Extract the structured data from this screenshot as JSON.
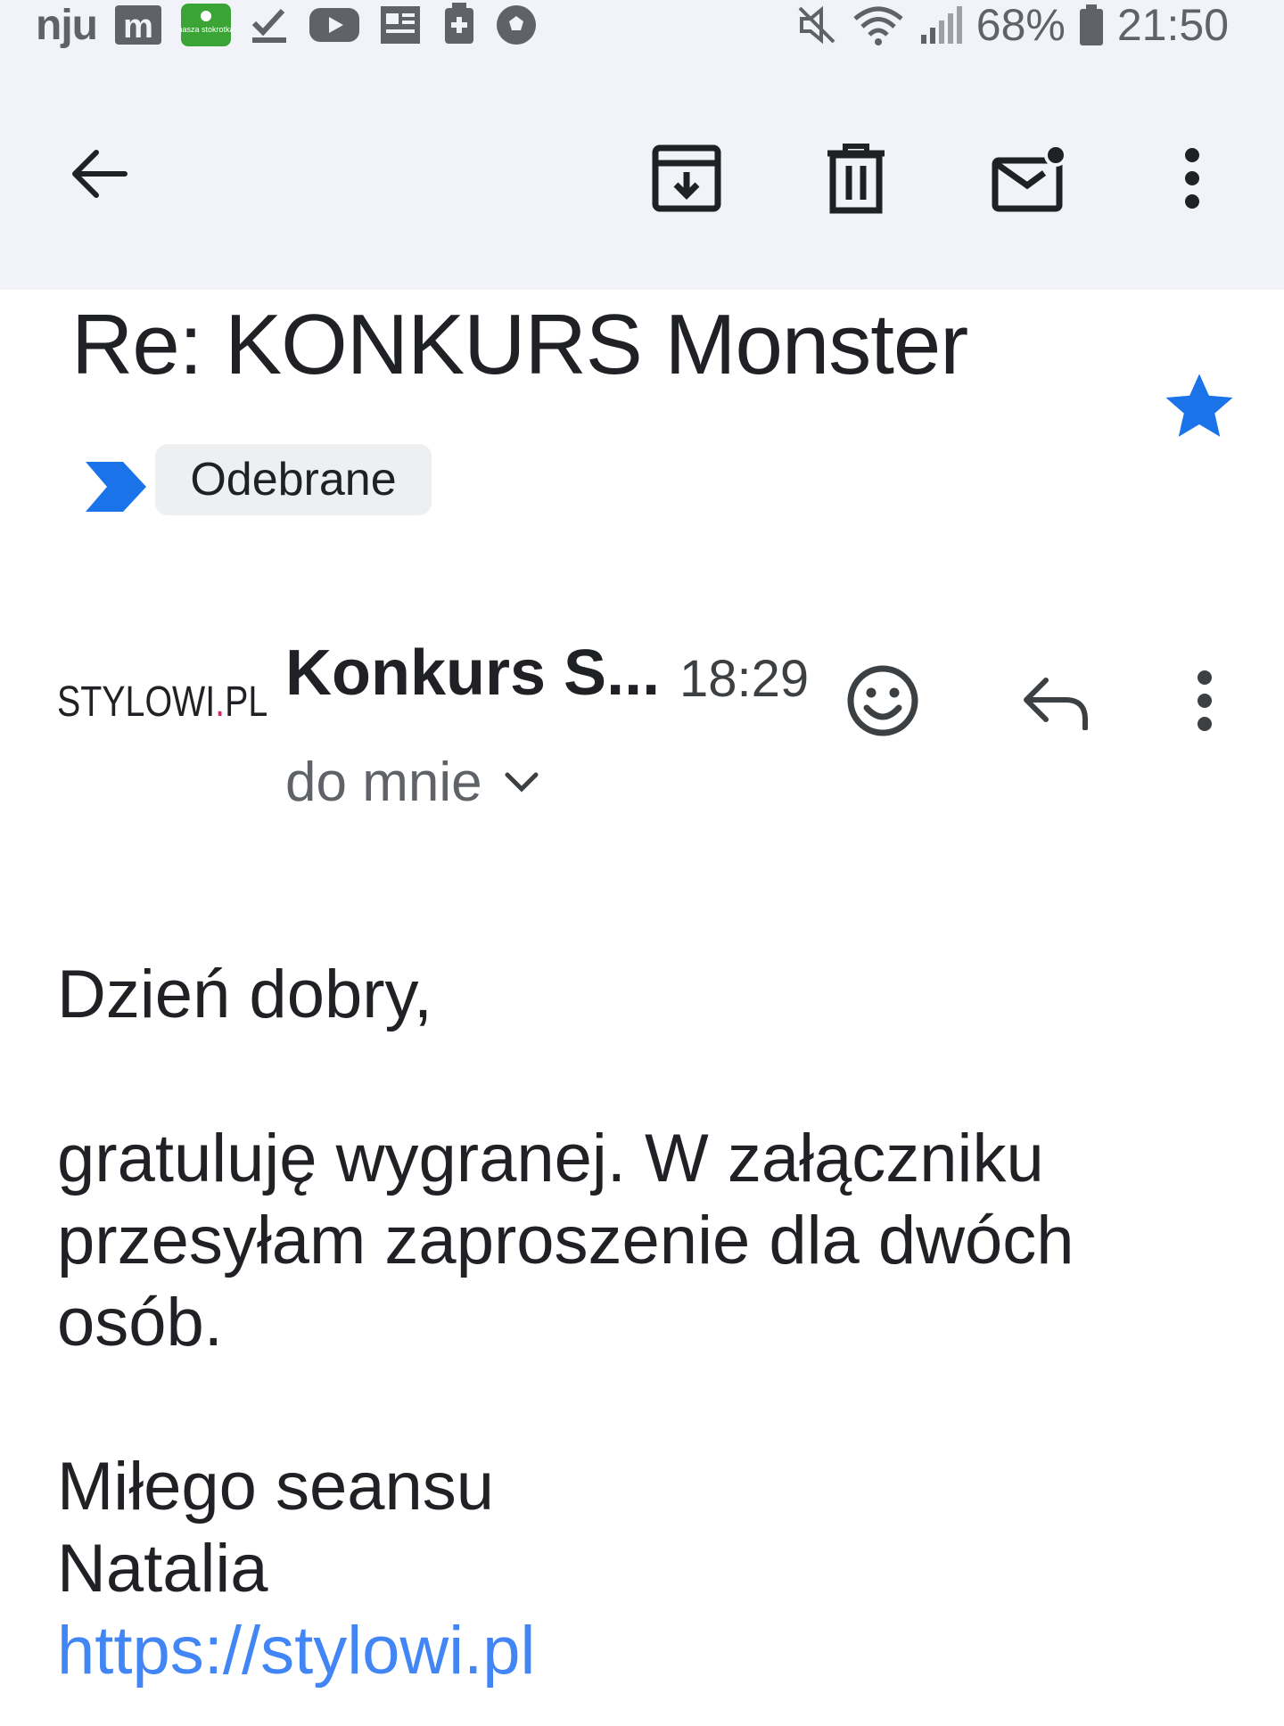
{
  "status_bar": {
    "carrier": "nju",
    "notification_icons": [
      "m-app-icon",
      "nasza-stokrotka-icon",
      "tasks-check-icon",
      "youtube-icon",
      "newspaper-icon",
      "medical-app-icon",
      "soccer-ball-icon"
    ],
    "app_badge_text": "nasza stokrotka",
    "app_m_letter": "m",
    "battery": "68%",
    "time": "21:50"
  },
  "toolbar": {
    "back": "back-arrow-icon",
    "archive": "archive-icon",
    "delete": "trash-icon",
    "mark_unread": "mark-unread-icon",
    "more": "more-vert-icon"
  },
  "email": {
    "subject": "Re: KONKURS Monster",
    "starred": true,
    "label": "Odebrane",
    "sender_logo_left": "STYLOWI",
    "sender_logo_dot": ".",
    "sender_logo_right": "PL",
    "sender_name": "Konkurs S...",
    "time": "18:29",
    "recipient": "do mnie",
    "body": {
      "greeting": "Dzień dobry,",
      "paragraph": "gratuluję wygranej. W załączniku przesyłam zaproszenie dla dwóch osób.",
      "closing": "Miłego seansu",
      "signature": "Natalia",
      "link": "https://stylowi.pl"
    }
  },
  "colors": {
    "top_bg": "#f1f3f8",
    "star": "#1a73e8",
    "label_arrow": "#1a73e8",
    "link": "#4285f4"
  }
}
